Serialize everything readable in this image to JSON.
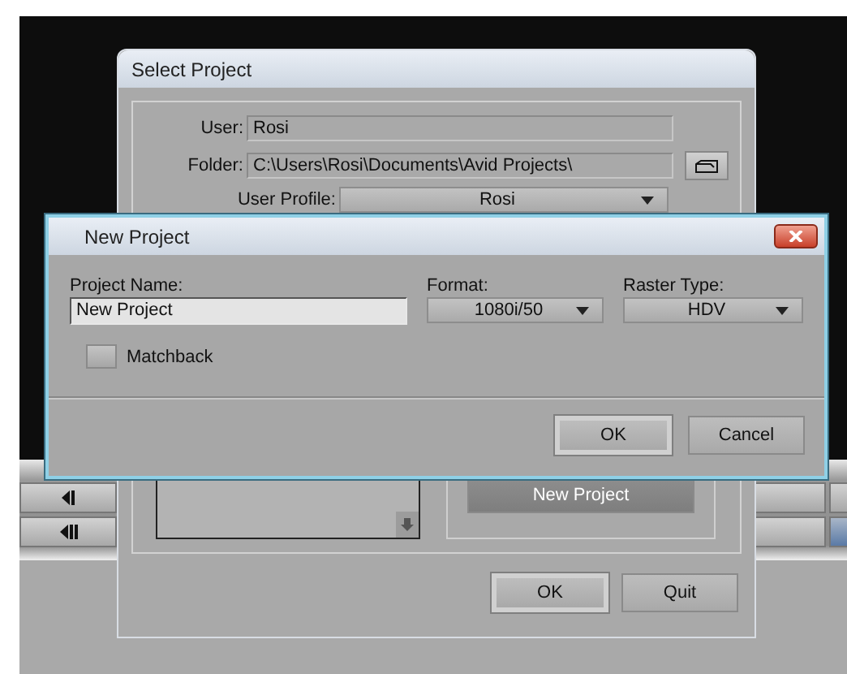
{
  "select_project": {
    "title": "Select Project",
    "user": {
      "label": "User:",
      "value": "Rosi"
    },
    "folder": {
      "label": "Folder:",
      "value": "C:\\Users\\Rosi\\Documents\\Avid Projects\\"
    },
    "user_profile": {
      "label": "User Profile:",
      "value": "Rosi"
    },
    "new_project_button": {
      "label": "New Project",
      "disabled": true
    },
    "buttons": [
      {
        "label": "OK",
        "default": true
      },
      {
        "label": "Quit",
        "default": false
      }
    ]
  },
  "new_project": {
    "title": "New Project",
    "project_name": {
      "label": "Project Name:",
      "value": "New Project"
    },
    "format": {
      "label": "Format:",
      "value": "1080i/50"
    },
    "raster_type": {
      "label": "Raster Type:",
      "value": "HDV"
    },
    "matchback": {
      "label": "Matchback",
      "checked": false
    },
    "buttons": [
      {
        "label": "OK",
        "default": true
      },
      {
        "label": "Cancel",
        "default": false
      }
    ]
  }
}
